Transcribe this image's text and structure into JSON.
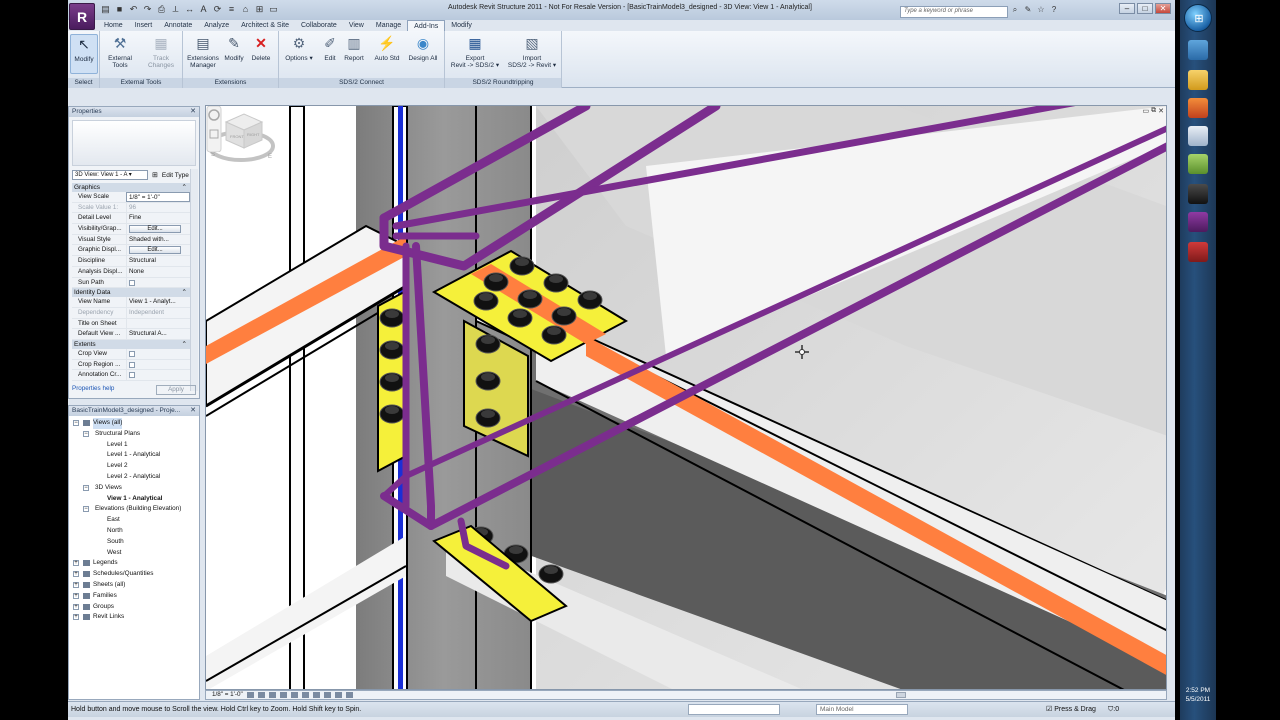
{
  "titlebar": {
    "app_button": "R",
    "window_title": "Autodesk Revit Structure 2011 - Not For Resale Version - [BasicTrainModel3_designed - 3D View: View 1 - Analytical]",
    "search_placeholder": "Type a keyword or phrase",
    "quick_access_icon": "A"
  },
  "ribbon": {
    "tabs": [
      "Home",
      "Insert",
      "Annotate",
      "Analyze",
      "Architect & Site",
      "Collaborate",
      "View",
      "Manage",
      "Add-Ins",
      "Modify"
    ],
    "active_tab": "Add-Ins",
    "groups": {
      "select": {
        "label": "Select",
        "modify": "Modify"
      },
      "external_tools": {
        "label": "External Tools",
        "external": "External",
        "tools": "Tools",
        "track": "Track",
        "changes": "Changes"
      },
      "extensions": {
        "label": "Extensions",
        "ext_manager_1": "Extensions",
        "ext_manager_2": "Manager",
        "modify": "Modify",
        "delete": "Delete"
      },
      "sds2_connect": {
        "label": "SDS/2 Connect",
        "options": "Options",
        "edit": "Edit",
        "report": "Report",
        "auto_std": "Auto Std",
        "design_all": "Design All"
      },
      "sds2_roundtrip": {
        "label": "SDS/2 Roundtripping",
        "export_1": "Export",
        "export_2": "Revit -> SDS/2",
        "import_1": "Import",
        "import_2": "SDS/2 -> Revit"
      }
    }
  },
  "properties": {
    "title": "Properties",
    "type_selector": "3D View: View 1 - A",
    "edit_type": "Edit Type",
    "sections": {
      "graphics": "Graphics",
      "identity": "Identity Data",
      "extents": "Extents"
    },
    "rows": {
      "view_scale": {
        "k": "View Scale",
        "v": "1/8\" = 1'-0\""
      },
      "scale_value": {
        "k": "Scale Value    1:",
        "v": "96"
      },
      "detail_level": {
        "k": "Detail Level",
        "v": "Fine"
      },
      "visibility": {
        "k": "Visibility/Grap...",
        "v": "Edit..."
      },
      "visual_style": {
        "k": "Visual Style",
        "v": "Shaded with..."
      },
      "graphic_display": {
        "k": "Graphic Displ...",
        "v": "Edit..."
      },
      "discipline": {
        "k": "Discipline",
        "v": "Structural"
      },
      "analysis_display": {
        "k": "Analysis Displ...",
        "v": "None"
      },
      "sun_path": {
        "k": "Sun Path",
        "v": ""
      },
      "view_name": {
        "k": "View Name",
        "v": "View 1 - Analyt..."
      },
      "dependency": {
        "k": "Dependency",
        "v": "Independent"
      },
      "title_on_sheet": {
        "k": "Title on Sheet",
        "v": ""
      },
      "default_view": {
        "k": "Default View ...",
        "v": "Structural A..."
      },
      "crop_view": {
        "k": "Crop View",
        "v": ""
      },
      "crop_region": {
        "k": "Crop Region ...",
        "v": ""
      },
      "annotation_crop": {
        "k": "Annotation Cr...",
        "v": ""
      }
    },
    "help_link": "Properties help",
    "apply": "Apply"
  },
  "browser": {
    "title": "BasicTrainModel3_designed - Proje...",
    "items": [
      {
        "label": "Views (all)",
        "level": 0
      },
      {
        "label": "Structural Plans",
        "level": 1
      },
      {
        "label": "Level 1",
        "level": 2
      },
      {
        "label": "Level 1 - Analytical",
        "level": 2
      },
      {
        "label": "Level 2",
        "level": 2
      },
      {
        "label": "Level 2 - Analytical",
        "level": 2
      },
      {
        "label": "3D Views",
        "level": 1
      },
      {
        "label": "View 1 - Analytical",
        "level": 2
      },
      {
        "label": "Elevations (Building Elevation)",
        "level": 1
      },
      {
        "label": "East",
        "level": 2
      },
      {
        "label": "North",
        "level": 2
      },
      {
        "label": "South",
        "level": 2
      },
      {
        "label": "West",
        "level": 2
      },
      {
        "label": "Legends",
        "level": 0
      },
      {
        "label": "Schedules/Quantities",
        "level": 0
      },
      {
        "label": "Sheets (all)",
        "level": 0
      },
      {
        "label": "Families",
        "level": 0
      },
      {
        "label": "Groups",
        "level": 0
      },
      {
        "label": "Revit Links",
        "level": 0
      }
    ]
  },
  "view": {
    "scale_label": "1/8\" = 1'-0\"",
    "cube_labels": {
      "front": "FRONT",
      "right": "RIGHT",
      "compass_s": "S",
      "compass_e": "E"
    },
    "colors": {
      "analytical": "#7b2d8e",
      "beam_flange": "#e6e6e6",
      "centerline": "#ff7f3f",
      "plate": "#f5f03a",
      "column": "#8c8c8c",
      "brace": "#1b2fd6"
    }
  },
  "status": {
    "message": "Hold button and move mouse to Scroll the view. Hold Ctrl key to Zoom. Hold Shift key to Spin.",
    "workset": "",
    "main_model": "Main Model",
    "press_drag": "Press & Drag",
    "filter_count": ":0"
  },
  "taskbar": {
    "time": "2:52 PM",
    "date": "5/5/2011"
  }
}
